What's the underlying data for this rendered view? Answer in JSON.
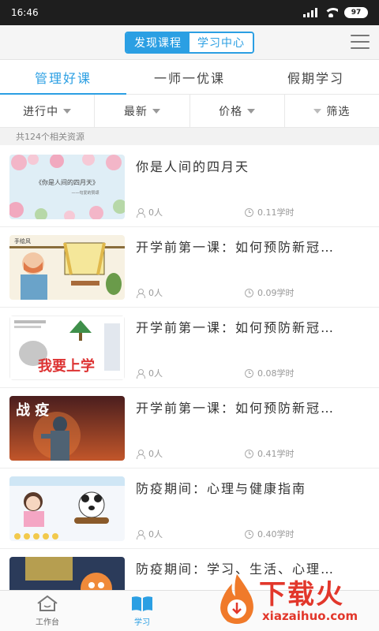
{
  "status_bar": {
    "time": "16:46",
    "battery": "97"
  },
  "header": {
    "segments": [
      "发现课程",
      "学习中心"
    ],
    "active_segment": 0
  },
  "tabs": [
    "管理好课",
    "一师一优课",
    "假期学习"
  ],
  "filters": [
    "进行中",
    "最新",
    "价格",
    "筛选"
  ],
  "result_count": "共124个相关资源",
  "courses": [
    {
      "title": "你是人间的四月天",
      "learners": "0人",
      "hours": "0.11学时"
    },
    {
      "title": "开学前第一课：如何预防新冠…",
      "learners": "0人",
      "hours": "0.09学时"
    },
    {
      "title": "开学前第一课：如何预防新冠…",
      "learners": "0人",
      "hours": "0.08学时"
    },
    {
      "title": "开学前第一课：如何预防新冠…",
      "learners": "0人",
      "hours": "0.41学时"
    },
    {
      "title": "防疫期间：心理与健康指南",
      "learners": "0人",
      "hours": "0.40学时"
    },
    {
      "title": "防疫期间：学习、生活、心理…",
      "learners": "",
      "hours": ""
    }
  ],
  "thumb_texts": {
    "t1_title": "《你是人间的四月天》",
    "t1_sub": "——句爱的赞颂",
    "t2_tag": "手绘风",
    "t3_tag": "我要上学",
    "t4_tag": "战  疫"
  },
  "bottom_nav": [
    {
      "label": "工作台",
      "icon": "home-icon"
    },
    {
      "label": "学习",
      "icon": "book-icon"
    }
  ],
  "watermark": {
    "brand": "下载火",
    "url": "xiazaihuo.com"
  },
  "colors": {
    "accent": "#2b9fe3",
    "watermark": "#e2372b"
  }
}
